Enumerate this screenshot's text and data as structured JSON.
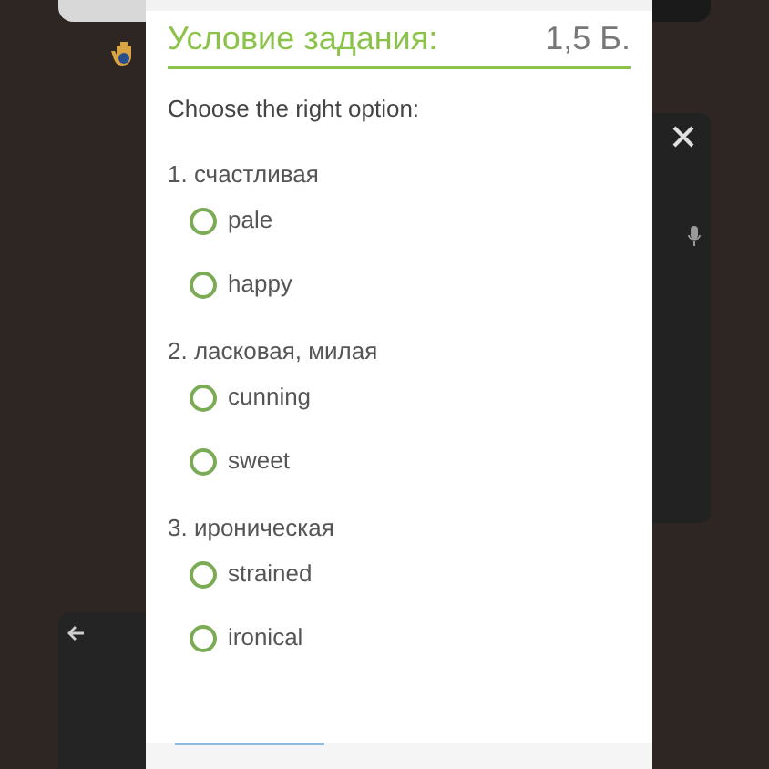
{
  "header": {
    "title": "Условие задания:",
    "points": "1,5 Б."
  },
  "instruction": "Choose the right option:",
  "questions": [
    {
      "prompt": "1. счастливая",
      "options": [
        {
          "label": "pale",
          "selected": false
        },
        {
          "label": "happy",
          "selected": false
        }
      ]
    },
    {
      "prompt": "2. ласковая, милая",
      "options": [
        {
          "label": "cunning",
          "selected": false
        },
        {
          "label": "sweet",
          "selected": false
        }
      ]
    },
    {
      "prompt": "3. ироническая",
      "options": [
        {
          "label": "strained",
          "selected": false
        },
        {
          "label": "ironical",
          "selected": false
        }
      ]
    }
  ]
}
